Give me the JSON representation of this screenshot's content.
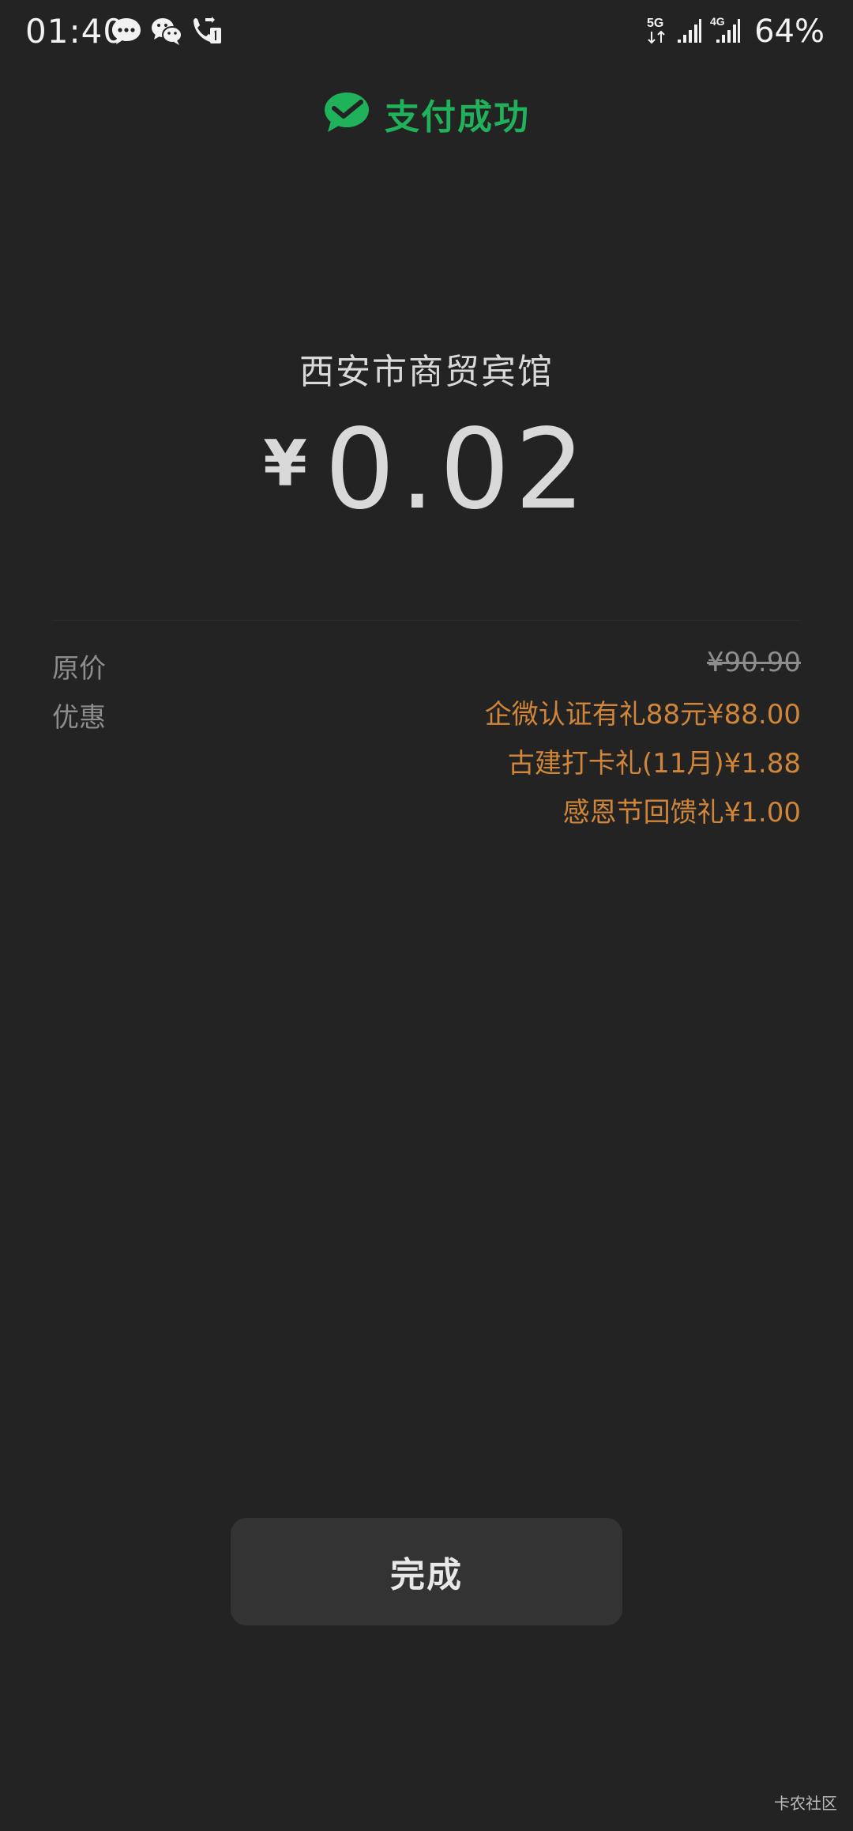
{
  "status_bar": {
    "time": "01:40",
    "network_5g": "5G",
    "network_4g": "4G",
    "battery": "64%",
    "icons": [
      "message-icon",
      "wechat-icon",
      "call-sim1-icon",
      "signal-icon",
      "signal-icon"
    ]
  },
  "header": {
    "icon": "wechat-pay-check-icon",
    "title": "支付成功",
    "title_color": "#1fb25a"
  },
  "merchant": {
    "name": "西安市商贸宾馆"
  },
  "payment": {
    "currency_symbol": "¥",
    "amount": "0.02"
  },
  "details": {
    "original_label": "原价",
    "original_value": "¥90.90",
    "discount_label": "优惠",
    "discount_color": "#d0863a",
    "discounts": [
      "企微认证有礼88元¥88.00",
      "古建打卡礼(11月)¥1.88",
      "感恩节回馈礼¥1.00"
    ]
  },
  "actions": {
    "done_label": "完成"
  },
  "watermark": "卡农社区"
}
